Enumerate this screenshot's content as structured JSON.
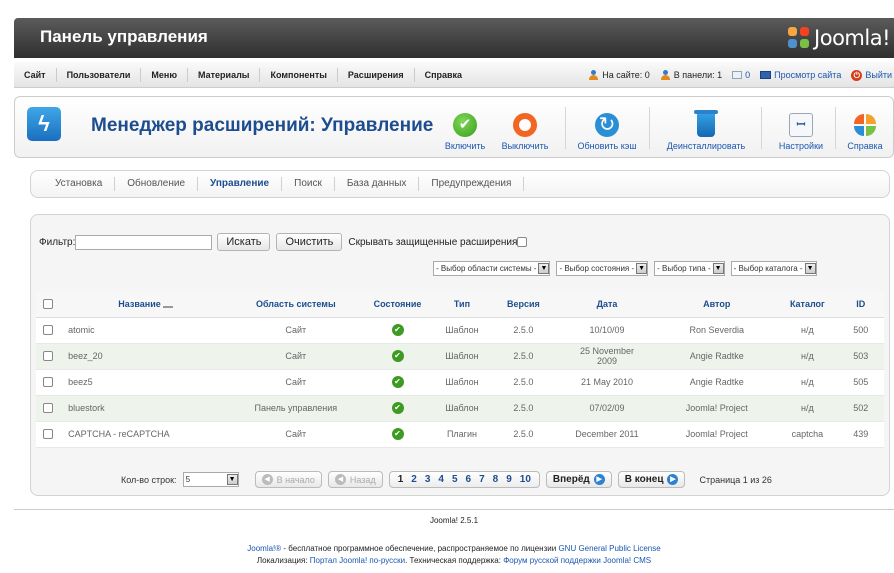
{
  "header": {
    "title": "Панель управления",
    "logo_text": "Joomla!"
  },
  "menu": [
    "Сайт",
    "Пользователи",
    "Меню",
    "Материалы",
    "Компоненты",
    "Расширения",
    "Справка"
  ],
  "status": {
    "on_site": "На сайте: 0",
    "in_panel": "В панели: 1",
    "messages": "0",
    "view_site": "Просмотр сайта",
    "logout": "Выйти"
  },
  "toolbar": {
    "page_title": "Менеджер расширений: Управление",
    "enable": "Включить",
    "disable": "Выключить",
    "refresh_cache": "Обновить кэш",
    "uninstall": "Деинсталлировать",
    "settings": "Настройки",
    "help": "Справка"
  },
  "tabs": [
    "Установка",
    "Обновление",
    "Управление",
    "Поиск",
    "База данных",
    "Предупреждения"
  ],
  "filter": {
    "label": "Фильтр:",
    "value": "",
    "search_button": "Искать",
    "clear_button": "Очистить",
    "hide_protected": "Скрывать защищенные расширения"
  },
  "selects": {
    "client": "- Выбор области системы -",
    "state": "- Выбор состояния -",
    "type": "- Выбор типа -",
    "folder": "- Выбор каталога -"
  },
  "table": {
    "columns": [
      "Название",
      "Область системы",
      "Состояние",
      "Тип",
      "Версия",
      "Дата",
      "Автор",
      "Каталог",
      "ID"
    ],
    "rows": [
      {
        "name": "atomic",
        "client": "Сайт",
        "type": "Шаблон",
        "version": "2.5.0",
        "date": "10/10/09",
        "author": "Ron Severdia",
        "folder": "н/д",
        "id": "500"
      },
      {
        "name": "beez_20",
        "client": "Сайт",
        "type": "Шаблон",
        "version": "2.5.0",
        "date": "25 November 2009",
        "author": "Angie Radtke",
        "folder": "н/д",
        "id": "503"
      },
      {
        "name": "beez5",
        "client": "Сайт",
        "type": "Шаблон",
        "version": "2.5.0",
        "date": "21 May 2010",
        "author": "Angie Radtke",
        "folder": "н/д",
        "id": "505"
      },
      {
        "name": "bluestork",
        "client": "Панель управления",
        "type": "Шаблон",
        "version": "2.5.0",
        "date": "07/02/09",
        "author": "Joomla! Project",
        "folder": "н/д",
        "id": "502"
      },
      {
        "name": "CAPTCHA - reCAPTCHA",
        "client": "Сайт",
        "type": "Плагин",
        "version": "2.5.0",
        "date": "December 2011",
        "author": "Joomla! Project",
        "folder": "captcha",
        "id": "439"
      }
    ]
  },
  "pager": {
    "rows_label": "Кол-во строк:",
    "rows_value": "5",
    "start": "В начало",
    "prev": "Назад",
    "pages": [
      "1",
      "2",
      "3",
      "4",
      "5",
      "6",
      "7",
      "8",
      "9",
      "10"
    ],
    "next": "Вперёд",
    "end": "В конец",
    "page_info": "Страница 1 из 26"
  },
  "footer": {
    "version": "Joomla! 2.5.1",
    "line1_link": "Joomla!®",
    "line1_text": " - бесплатное программное обеспечение, распространяемое по лицензии ",
    "line1_license": "GNU General Public License",
    "line2_label": "Локализация: ",
    "line2_link1": "Портал Joomla! по-русски",
    "line2_mid": ". Техническая поддержка: ",
    "line2_link2": "Форум русской поддержки Joomla! CMS"
  }
}
